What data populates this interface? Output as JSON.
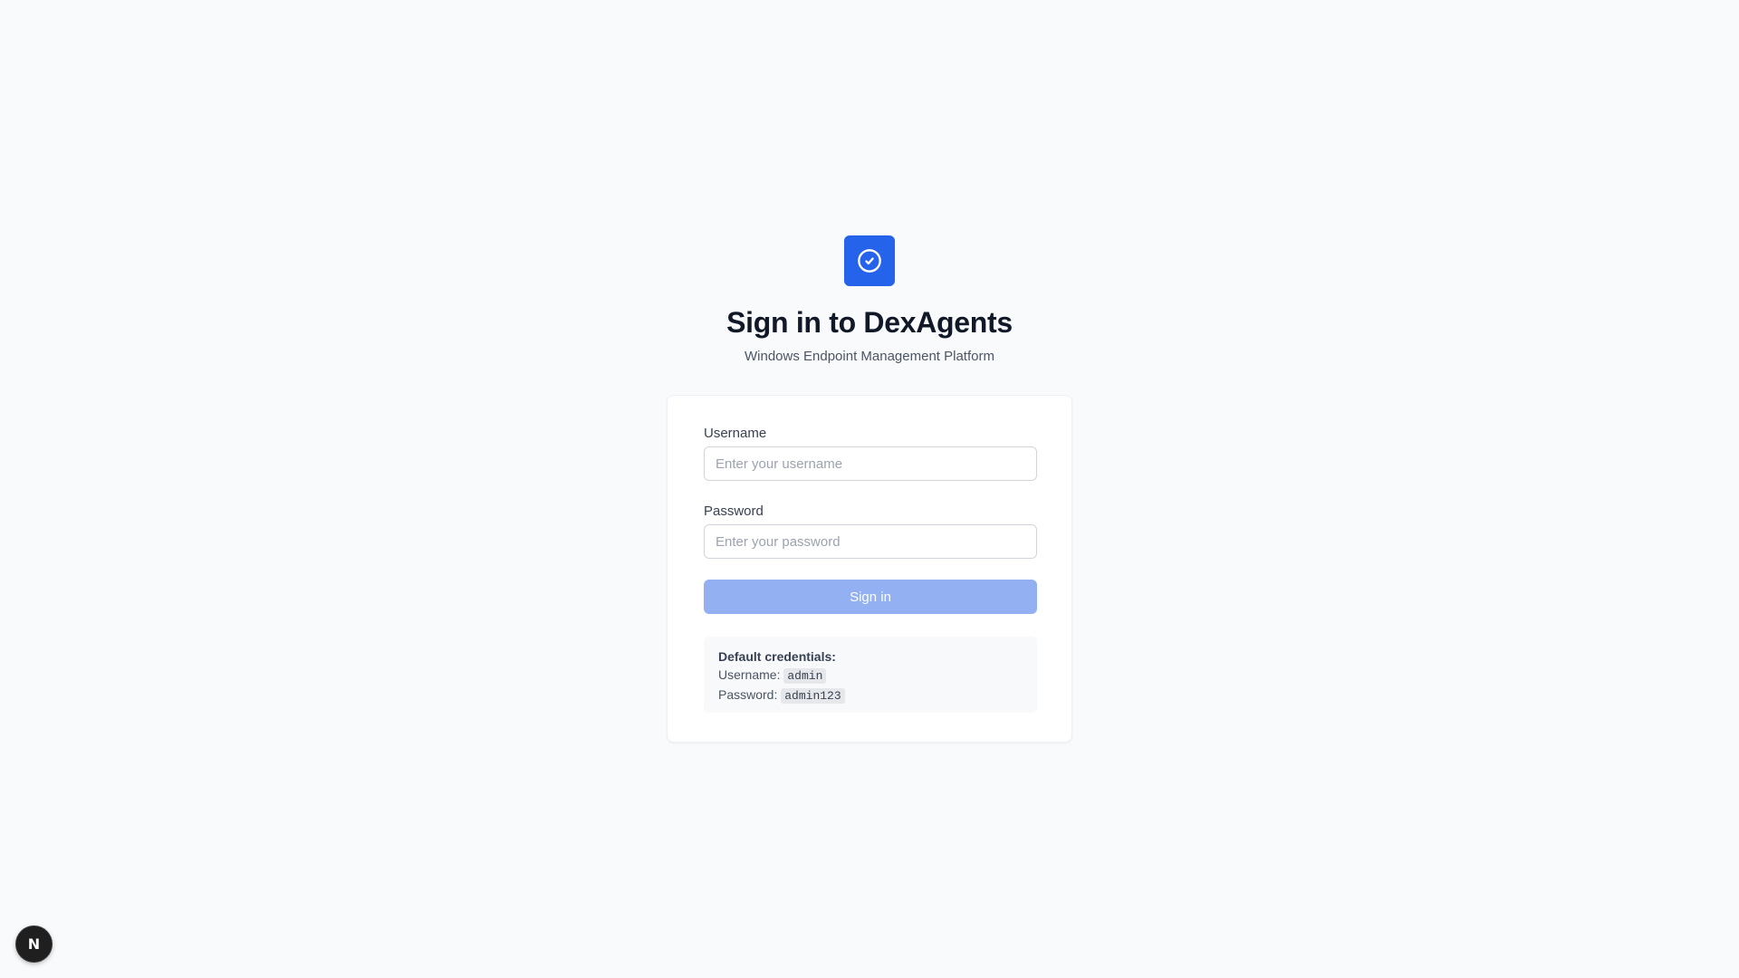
{
  "brand": {
    "logo_icon": "check-circle-icon",
    "accent_color": "#2563eb"
  },
  "header": {
    "title": "Sign in to DexAgents",
    "subtitle": "Windows Endpoint Management Platform"
  },
  "form": {
    "username_label": "Username",
    "username_placeholder": "Enter your username",
    "username_value": "",
    "password_label": "Password",
    "password_placeholder": "Enter your password",
    "password_value": "",
    "submit_label": "Sign in",
    "submit_color": "#93b0f3"
  },
  "credentials": {
    "heading": "Default credentials:",
    "username_label": "Username:",
    "username_value": "admin",
    "password_label": "Password:",
    "password_value": "admin123"
  },
  "dev_indicator": {
    "label": "N",
    "icon": "nextjs-icon"
  }
}
